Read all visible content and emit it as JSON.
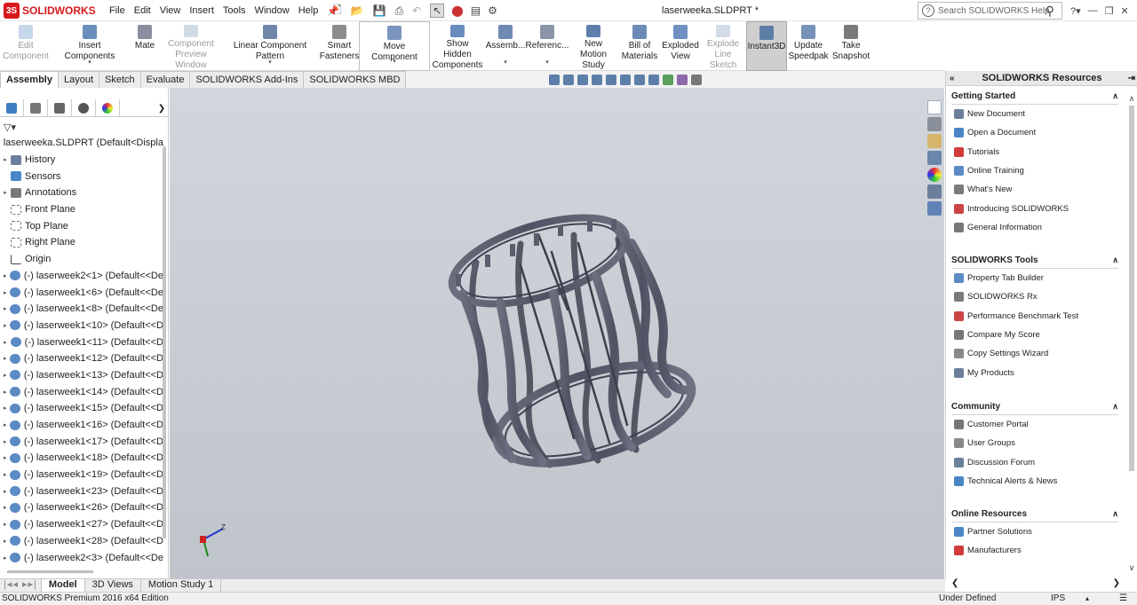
{
  "app": {
    "name": "SOLIDWORKS",
    "doc_title": "laserweeka.SLDPRT *"
  },
  "menu": [
    "File",
    "Edit",
    "View",
    "Insert",
    "Tools",
    "Window",
    "Help"
  ],
  "search": {
    "placeholder": "Search SOLIDWORKS Help"
  },
  "commands": [
    {
      "label": "Edit Component",
      "disabled": true
    },
    {
      "label": "Insert Components",
      "disabled": false
    },
    {
      "label": "Mate",
      "disabled": false
    },
    {
      "label": "Component Preview Window",
      "disabled": true
    },
    {
      "label": "Linear Component Pattern",
      "disabled": false
    },
    {
      "label": "Smart Fasteners",
      "disabled": false
    },
    {
      "label": "Move Component",
      "disabled": false
    },
    {
      "label": "Show Hidden Components",
      "disabled": false
    },
    {
      "label": "Assemb...",
      "disabled": false
    },
    {
      "label": "Referenc...",
      "disabled": false
    },
    {
      "label": "New Motion Study",
      "disabled": false
    },
    {
      "label": "Bill of Materials",
      "disabled": false
    },
    {
      "label": "Exploded View",
      "disabled": false
    },
    {
      "label": "Explode Line Sketch",
      "disabled": true
    },
    {
      "label": "Instant3D",
      "disabled": false
    },
    {
      "label": "Update Speedpak",
      "disabled": false
    },
    {
      "label": "Take Snapshot",
      "disabled": false
    }
  ],
  "cm_tabs": [
    "Assembly",
    "Layout",
    "Sketch",
    "Evaluate",
    "SOLIDWORKS Add-Ins",
    "SOLIDWORKS MBD"
  ],
  "tree": {
    "root": "laserweeka.SLDPRT  (Default<Displa",
    "items": [
      {
        "label": "History",
        "expand": true
      },
      {
        "label": "Sensors",
        "expand": false
      },
      {
        "label": "Annotations",
        "expand": true
      },
      {
        "label": "Front Plane",
        "expand": false
      },
      {
        "label": "Top Plane",
        "expand": false
      },
      {
        "label": "Right Plane",
        "expand": false
      },
      {
        "label": "Origin",
        "expand": false
      },
      {
        "label": "(-) laserweek2<1> (Default<<De",
        "expand": true
      },
      {
        "label": "(-) laserweek1<6> (Default<<De",
        "expand": true
      },
      {
        "label": "(-) laserweek1<8> (Default<<De",
        "expand": true
      },
      {
        "label": "(-) laserweek1<10> (Default<<D",
        "expand": true
      },
      {
        "label": "(-) laserweek1<11> (Default<<D",
        "expand": true
      },
      {
        "label": "(-) laserweek1<12> (Default<<D",
        "expand": true
      },
      {
        "label": "(-) laserweek1<13> (Default<<D",
        "expand": true
      },
      {
        "label": "(-) laserweek1<14> (Default<<D",
        "expand": true
      },
      {
        "label": "(-) laserweek1<15> (Default<<D",
        "expand": true
      },
      {
        "label": "(-) laserweek1<16> (Default<<D",
        "expand": true
      },
      {
        "label": "(-) laserweek1<17> (Default<<D",
        "expand": true
      },
      {
        "label": "(-) laserweek1<18> (Default<<D",
        "expand": true
      },
      {
        "label": "(-) laserweek1<19> (Default<<D",
        "expand": true
      },
      {
        "label": "(-) laserweek1<23> (Default<<D",
        "expand": true
      },
      {
        "label": "(-) laserweek1<26> (Default<<D",
        "expand": true
      },
      {
        "label": "(-) laserweek1<27> (Default<<D",
        "expand": true
      },
      {
        "label": "(-) laserweek1<28> (Default<<D",
        "expand": true
      },
      {
        "label": "(-) laserweek2<3> (Default<<De",
        "expand": true
      }
    ]
  },
  "resources": {
    "title": "SOLIDWORKS Resources",
    "sections": [
      {
        "title": "Getting Started",
        "items": [
          "New Document",
          "Open a Document",
          "Tutorials",
          "Online Training",
          "What's New",
          "Introducing SOLIDWORKS",
          "General Information"
        ]
      },
      {
        "title": "SOLIDWORKS Tools",
        "items": [
          "Property Tab Builder",
          "SOLIDWORKS Rx",
          "Performance Benchmark Test",
          "Compare My Score",
          "Copy Settings Wizard",
          "My Products"
        ]
      },
      {
        "title": "Community",
        "items": [
          "Customer Portal",
          "User Groups",
          "Discussion Forum",
          "Technical Alerts & News"
        ]
      },
      {
        "title": "Online Resources",
        "items": [
          "Partner Solutions",
          "Manufacturers"
        ]
      }
    ]
  },
  "bottom_tabs": [
    "Model",
    "3D Views",
    "Motion Study 1"
  ],
  "status": {
    "left": "SOLIDWORKS Premium 2016 x64 Edition",
    "state": "Under Defined",
    "units": "IPS"
  },
  "triad": {
    "z_label": "Z"
  },
  "colors": {
    "brand": "#d7191b",
    "viewport_top": "#d2d6dc",
    "model": "#5d6170"
  }
}
